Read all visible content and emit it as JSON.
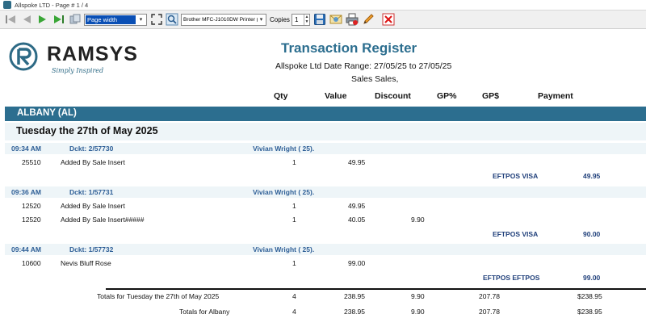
{
  "window": {
    "title": "Allspoke LTD - Page # 1 / 4"
  },
  "toolbar": {
    "zoom_value": "Page width",
    "printer_value": "Brother MFC-J1010DW Printer (r",
    "copies_label": "Copies",
    "copies_value": "1"
  },
  "report": {
    "logo_name": "RAMSYS",
    "logo_tagline": "Simply Inspired",
    "title": "Transaction Register",
    "subtitle": "Allspoke Ltd  Date Range: 27/05/25 to 27/05/25",
    "subtitle2": "Sales  Sales,",
    "columns": {
      "qty": "Qty",
      "value": "Value",
      "discount": "Discount",
      "gp_pct": "GP%",
      "gp_dollar": "GP$",
      "payment": "Payment"
    },
    "branch": "ALBANY  (AL)",
    "day": "Tuesday the 27th of May 2025",
    "dockets": [
      {
        "time": "09:34 AM",
        "docket": "Dckt: 2/57730",
        "customer": "Vivian Wright ( 25).",
        "lines": [
          {
            "code": "25510",
            "desc": "Added By Sale Insert",
            "qty": "1",
            "value": "49.95",
            "discount": ""
          }
        ],
        "payment_method": "EFTPOS VISA",
        "payment_amount": "49.95"
      },
      {
        "time": "09:36 AM",
        "docket": "Dckt: 1/57731",
        "customer": "Vivian Wright ( 25).",
        "lines": [
          {
            "code": "12520",
            "desc": "Added By Sale Insert",
            "qty": "1",
            "value": "49.95",
            "discount": ""
          },
          {
            "code": "12520",
            "desc": "Added By Sale Insert#####",
            "qty": "1",
            "value": "40.05",
            "discount": "9.90"
          }
        ],
        "payment_method": "EFTPOS VISA",
        "payment_amount": "90.00"
      },
      {
        "time": "09:44 AM",
        "docket": "Dckt: 1/57732",
        "customer": "Vivian Wright ( 25).",
        "lines": [
          {
            "code": "10600",
            "desc": "Nevis Bluff Rose",
            "qty": "1",
            "value": "99.00",
            "discount": ""
          }
        ],
        "payment_method": "EFTPOS EFTPOS",
        "payment_amount": "99.00"
      }
    ],
    "totals": [
      {
        "label": "Totals for Tuesday the 27th of May 2025",
        "qty": "4",
        "value": "238.95",
        "discount": "9.90",
        "gp_dollar": "207.78",
        "payment": "$238.95"
      },
      {
        "label": "Totals for Albany",
        "qty": "4",
        "value": "238.95",
        "discount": "9.90",
        "gp_dollar": "207.78",
        "payment": "$238.95"
      }
    ]
  },
  "colors": {
    "accent": "#2c6e8f",
    "docket_text": "#2d5e96",
    "payment_text": "#1f3f7a",
    "row_tint": "#eef5f8"
  }
}
